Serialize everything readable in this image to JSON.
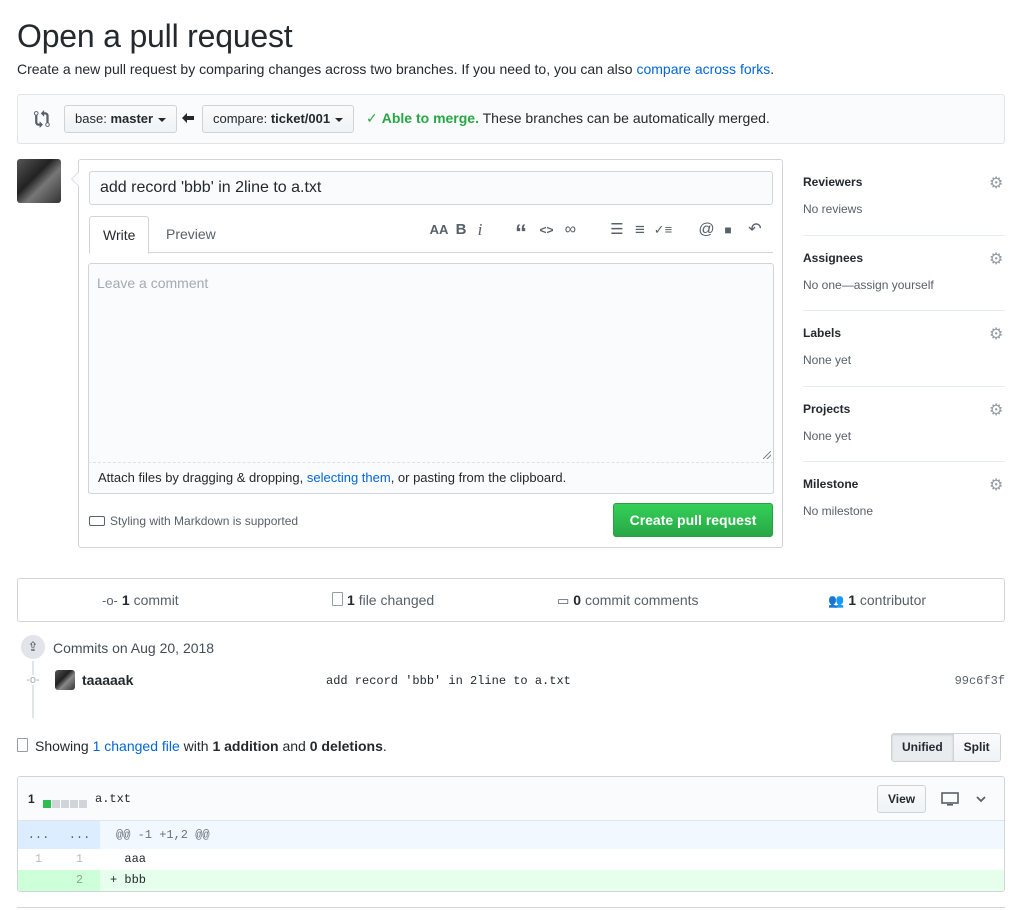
{
  "header": {
    "title": "Open a pull request",
    "subtitle_prefix": "Create a new pull request by comparing changes across two branches. If you need to, you can also ",
    "subtitle_link": "compare across forks",
    "subtitle_suffix": "."
  },
  "compare": {
    "base_label": "base:",
    "base_branch": "master",
    "compare_label": "compare:",
    "compare_branch": "ticket/001",
    "merge_ok": "Able to merge.",
    "merge_msg": "These branches can be automatically merged."
  },
  "form": {
    "title_value": "add record 'bbb' in 2line to a.txt",
    "tab_write": "Write",
    "tab_preview": "Preview",
    "comment_placeholder": "Leave a comment",
    "attach_prefix": "Attach files by dragging & dropping, ",
    "attach_link": "selecting them",
    "attach_suffix": ", or pasting from the clipboard.",
    "markdown_note": "Styling with Markdown is supported",
    "create_button": "Create pull request",
    "toolbar": {
      "header": "AA",
      "bold": "B",
      "italic": "i",
      "quote": "“",
      "code": "<>",
      "link": "∞",
      "ul": "☰",
      "ol": "≡",
      "task": "✓≡",
      "mention": "@",
      "bookmark": "■",
      "reply": "↶"
    }
  },
  "sidebar": {
    "sections": [
      {
        "title": "Reviewers",
        "value": "No reviews"
      },
      {
        "title": "Assignees",
        "value": "No one—assign yourself"
      },
      {
        "title": "Labels",
        "value": "None yet"
      },
      {
        "title": "Projects",
        "value": "None yet"
      },
      {
        "title": "Milestone",
        "value": "No milestone"
      }
    ]
  },
  "stats": {
    "commits_count": "1",
    "commits_label": "commit",
    "files_count": "1",
    "files_label": "file changed",
    "comments_count": "0",
    "comments_label": "commit comments",
    "contributors_count": "1",
    "contributors_label": "contributor"
  },
  "commits": {
    "date_heading": "Commits on Aug 20, 2018",
    "items": [
      {
        "author": "taaaaak",
        "message": "add record 'bbb' in 2line to a.txt",
        "sha": "99c6f3f"
      }
    ]
  },
  "diff_summary": {
    "showing": "Showing ",
    "changed_link": "1 changed file",
    "with": " with ",
    "additions": "1 addition",
    "and": " and ",
    "deletions": "0 deletions",
    "end": ".",
    "unified": "Unified",
    "split": "Split"
  },
  "diff_file": {
    "count": "1",
    "filename": "a.txt",
    "view_button": "View",
    "hunk_old": "...",
    "hunk_new": "...",
    "hunk_header": "@@ -1 +1,2 @@",
    "lines": [
      {
        "old": "1",
        "new": "1",
        "text": "  aaa",
        "type": "context"
      },
      {
        "old": "",
        "new": "2",
        "text": "+ bbb",
        "type": "added"
      }
    ]
  },
  "colors": {
    "accent": "#0366d6",
    "success": "#28a745",
    "added_bg": "#e6ffed"
  }
}
